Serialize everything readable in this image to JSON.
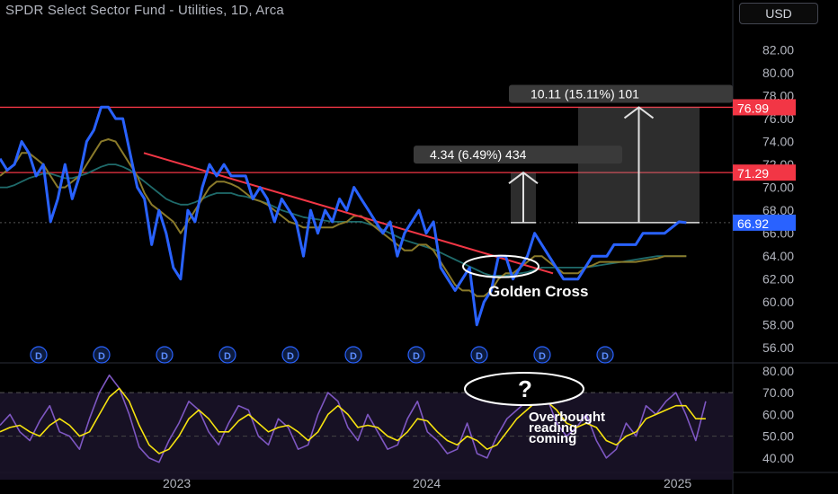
{
  "header": {
    "title": "SPDR Select Sector Fund - Utilities, 1D, Arca",
    "currency_button": "USD"
  },
  "colors": {
    "price": "#2962ff",
    "ma_fast": "#8a7a2a",
    "ma_slow": "#1f6b6b",
    "resistance": "#f23645",
    "trendline": "#f23645",
    "rsi": "#7e57c2",
    "rsi_ma": "#f6e30f",
    "last_price_badge": "#2962ff"
  },
  "chart_data": [
    {
      "type": "line",
      "panel": "price",
      "x_axis": {
        "ticks": [
          "2023",
          "2024",
          "2025"
        ]
      },
      "y_axis": {
        "ylim": [
          55,
          84
        ],
        "ticks": [
          "82.00",
          "80.00",
          "78.00",
          "76.00",
          "74.00",
          "72.00",
          "70.00",
          "68.00",
          "66.00",
          "64.00",
          "62.00",
          "60.00",
          "58.00",
          "56.00"
        ]
      },
      "x": [
        0,
        6,
        12,
        18,
        24,
        30,
        36,
        42,
        48,
        54,
        60,
        66,
        72,
        78,
        84,
        90,
        96,
        102,
        108,
        114,
        120,
        126,
        132,
        138,
        144,
        150,
        156,
        162,
        168,
        174,
        180,
        186,
        192,
        198,
        204,
        210,
        216,
        222,
        228,
        234,
        240,
        246,
        252,
        258,
        264,
        270,
        276,
        282,
        288,
        294,
        300,
        306,
        312,
        318,
        324,
        330,
        336,
        342,
        348,
        354,
        360,
        366,
        372,
        378,
        384,
        390,
        396,
        402,
        408,
        414,
        420,
        426,
        432,
        438,
        444,
        450,
        456,
        462,
        468,
        474,
        480,
        486,
        492,
        498,
        504,
        510,
        516,
        522,
        528,
        534,
        540,
        546,
        552,
        558,
        564,
        570
      ],
      "series": [
        {
          "key": "price",
          "values": [
            72.5,
            71.5,
            72,
            74,
            73,
            71,
            72,
            67,
            69,
            72,
            69,
            71,
            74,
            75,
            77,
            77,
            76,
            76,
            73,
            70,
            69,
            65,
            68,
            66,
            63,
            62,
            68,
            67,
            70,
            72,
            71,
            72,
            71,
            71,
            71,
            69,
            70,
            69,
            67,
            69,
            68,
            67,
            64,
            68,
            66,
            68,
            67,
            69,
            68,
            70,
            69,
            68,
            67,
            66,
            67,
            64,
            66,
            67,
            68,
            66,
            67,
            63,
            62,
            61,
            62,
            63,
            58,
            60,
            61,
            64,
            64,
            62,
            63,
            64,
            66,
            65,
            64,
            63,
            62,
            62,
            62,
            63,
            64,
            64,
            64,
            65,
            65,
            65,
            65,
            66,
            66,
            66,
            66,
            66.5,
            67,
            66.92
          ]
        },
        {
          "key": "ma_fast",
          "values": [
            71,
            71.5,
            72,
            73,
            73,
            72.5,
            72,
            71,
            70,
            70,
            70.5,
            71,
            72,
            73,
            74,
            74.2,
            74,
            73,
            72,
            71,
            69.5,
            68.5,
            68,
            67.5,
            67,
            66,
            67,
            68,
            69,
            70,
            70.5,
            70.5,
            70.3,
            70,
            69.5,
            69,
            68.8,
            68.5,
            68,
            67.5,
            67,
            66.8,
            66.5,
            66.5,
            66.5,
            66.5,
            66.5,
            66.8,
            67,
            67.5,
            67.5,
            67,
            66.5,
            66,
            65.5,
            65,
            64.5,
            64.5,
            65,
            65,
            64.5,
            63.5,
            62.5,
            61.5,
            61,
            61,
            60.5,
            60.5,
            61,
            62,
            62.5,
            62.5,
            63,
            63.5,
            64,
            64,
            63.5,
            63,
            62.5,
            62.5,
            62.5,
            63,
            63.2,
            63.5,
            63.5,
            63.5,
            63.5,
            63.5,
            63.5,
            63.6,
            63.7,
            63.8,
            64,
            64,
            64,
            64
          ]
        },
        {
          "key": "ma_slow",
          "values": [
            70,
            70,
            70.2,
            70.5,
            70.8,
            71,
            71.2,
            71.2,
            71,
            70.8,
            70.8,
            71,
            71.2,
            71.5,
            71.8,
            72,
            72,
            71.8,
            71.5,
            71,
            70.5,
            70,
            69.5,
            69,
            68.7,
            68.5,
            68.5,
            68.7,
            69,
            69.3,
            69.5,
            69.5,
            69.5,
            69.3,
            69.2,
            69,
            68.8,
            68.6,
            68.3,
            68,
            67.8,
            67.6,
            67.4,
            67.3,
            67.2,
            67.1,
            67,
            67,
            67,
            67,
            67,
            66.8,
            66.6,
            66.3,
            66,
            65.7,
            65.4,
            65.2,
            65,
            64.8,
            64.6,
            64.3,
            64,
            63.7,
            63.4,
            63.1,
            62.8,
            62.5,
            62.3,
            62.3,
            62.3,
            62.4,
            62.5,
            62.6,
            62.8,
            63,
            63,
            63,
            63,
            63,
            63,
            63,
            63.1,
            63.2,
            63.3,
            63.4,
            63.5,
            63.6,
            63.7,
            63.8,
            63.9,
            64,
            64,
            64,
            64,
            64
          ]
        }
      ],
      "levels": [
        {
          "name": "resistance",
          "value": 76.99,
          "label": "76.99"
        },
        {
          "name": "resistance",
          "value": 71.29,
          "label": "71.29"
        }
      ],
      "last_price": {
        "value": 66.92,
        "label": "66.92"
      },
      "trendline": {
        "x": [
          160,
          615
        ],
        "y": [
          73,
          62.5
        ]
      },
      "measures": [
        {
          "label": "4.34 (6.49%) 434",
          "from": 66.92,
          "to": 71.29
        },
        {
          "label": "10.11 (15.11%) 101",
          "from": 66.92,
          "to": 76.99
        }
      ],
      "annotations": [
        "Golden Cross"
      ],
      "dividend_markers": [
        "D",
        "D",
        "D",
        "D",
        "D",
        "D",
        "D",
        "D",
        "D",
        "D"
      ]
    },
    {
      "type": "line",
      "panel": "rsi",
      "y_axis": {
        "ylim": [
          35,
          82
        ],
        "ticks": [
          "80.00",
          "70.00",
          "60.00",
          "50.00",
          "40.00"
        ]
      },
      "bands": [
        70,
        30
      ],
      "x": [
        0,
        8,
        16,
        24,
        32,
        40,
        48,
        56,
        64,
        72,
        80,
        88,
        96,
        104,
        112,
        120,
        128,
        136,
        144,
        152,
        160,
        168,
        176,
        184,
        192,
        200,
        208,
        216,
        224,
        232,
        240,
        248,
        256,
        264,
        272,
        280,
        288,
        296,
        304,
        312,
        320,
        328,
        336,
        344,
        352,
        360,
        368,
        376,
        384,
        392,
        400,
        408,
        416,
        424,
        432,
        440,
        448,
        456,
        464,
        472,
        480,
        488,
        496,
        504,
        512,
        520,
        528,
        536,
        544,
        552,
        560,
        568
      ],
      "series": [
        {
          "key": "rsi",
          "values": [
            55,
            60,
            52,
            48,
            57,
            64,
            52,
            50,
            44,
            58,
            70,
            78,
            72,
            60,
            45,
            40,
            38,
            48,
            56,
            66,
            62,
            52,
            46,
            56,
            64,
            62,
            50,
            46,
            58,
            54,
            44,
            46,
            60,
            70,
            66,
            54,
            48,
            60,
            52,
            44,
            46,
            58,
            66,
            52,
            48,
            42,
            44,
            56,
            42,
            40,
            50,
            58,
            62,
            66,
            72,
            68,
            56,
            50,
            54,
            60,
            48,
            40,
            44,
            56,
            50,
            64,
            60,
            66,
            70,
            60,
            48,
            66
          ]
        },
        {
          "key": "rsi_ma",
          "values": [
            52,
            54,
            55,
            52,
            50,
            55,
            58,
            55,
            50,
            52,
            60,
            68,
            72,
            66,
            55,
            46,
            42,
            44,
            50,
            58,
            62,
            58,
            52,
            52,
            57,
            60,
            56,
            52,
            54,
            55,
            52,
            48,
            52,
            60,
            64,
            60,
            54,
            55,
            54,
            50,
            48,
            52,
            58,
            57,
            52,
            48,
            46,
            50,
            48,
            44,
            46,
            52,
            58,
            62,
            66,
            66,
            62,
            56,
            54,
            56,
            54,
            48,
            46,
            50,
            52,
            58,
            60,
            62,
            64,
            64,
            58,
            58
          ]
        }
      ],
      "annotations": [
        "Overbought",
        "reading",
        "coming",
        "?"
      ]
    }
  ]
}
